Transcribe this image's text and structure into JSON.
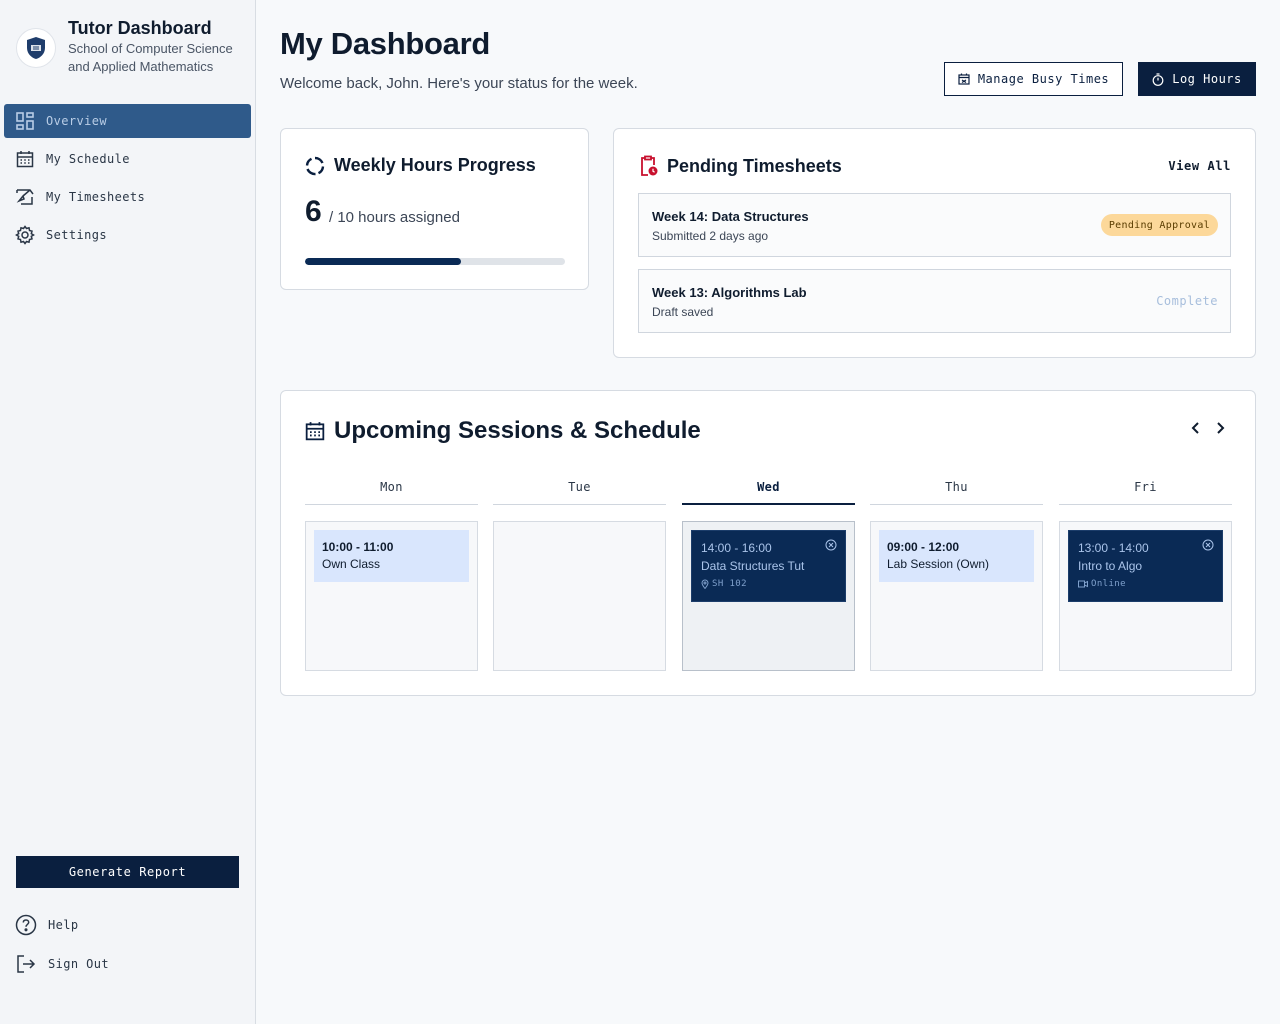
{
  "brand": {
    "title": "Tutor Dashboard",
    "subtitle": "School of Computer Science and Applied Mathematics"
  },
  "nav": {
    "overview": "Overview",
    "schedule": "My Schedule",
    "timesheets": "My Timesheets",
    "settings": "Settings"
  },
  "sidebar_bottom": {
    "generate": "Generate Report",
    "help": "Help",
    "signout": "Sign Out"
  },
  "header": {
    "title": "My Dashboard",
    "welcome": "Welcome back, John. Here's your status for the week.",
    "manage_busy": "Manage Busy Times",
    "log_hours": "Log Hours"
  },
  "weekly": {
    "title": "Weekly Hours Progress",
    "hours_done": "6",
    "hours_text": "/ 10 hours assigned",
    "progress_fraction": 0.6
  },
  "pending": {
    "title": "Pending Timesheets",
    "view_all": "View All",
    "items": [
      {
        "title": "Week 14: Data Structures",
        "sub": "Submitted 2 days ago",
        "status": "Pending Approval"
      },
      {
        "title": "Week 13: Algorithms Lab",
        "sub": "Draft saved",
        "status": "Complete"
      }
    ]
  },
  "upcoming": {
    "title": "Upcoming Sessions & Schedule",
    "days": [
      "Mon",
      "Tue",
      "Wed",
      "Thu",
      "Fri"
    ],
    "events": {
      "mon": {
        "time": "10:00 - 11:00",
        "name": "Own Class"
      },
      "wed": {
        "time": "14:00 - 16:00",
        "name": "Data Structures Tut",
        "location": "SH 102"
      },
      "thu": {
        "time": "09:00 - 12:00",
        "name": "Lab Session (Own)"
      },
      "fri": {
        "time": "13:00 - 14:00",
        "name": "Intro to Algo",
        "location": "Online"
      }
    }
  },
  "colors": {
    "primary": "#0a1f3f",
    "nav_active": "#2f5a8a",
    "pending_badge": "#fcd89a",
    "alert_red": "#c8102e"
  }
}
